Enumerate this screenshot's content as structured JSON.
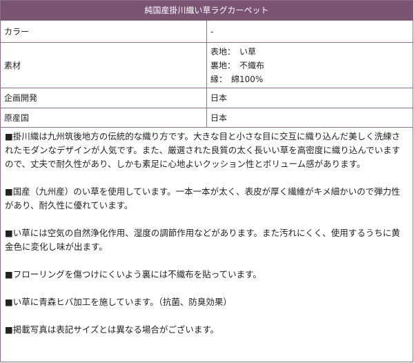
{
  "title": "純国産掛川織い草ラグカーペット",
  "specs": {
    "color": {
      "label": "カラー",
      "value": "-"
    },
    "material": {
      "label": "素材",
      "lines": [
        "表地：　い草",
        "裏地：　不織布",
        "縁：　綿100%"
      ]
    },
    "planning": {
      "label": "企画開発",
      "value": "日本"
    },
    "origin": {
      "label": "原産国",
      "value": "日本"
    }
  },
  "description": [
    "■掛川織は九州筑後地方の伝統的な織り方です。大きな目と小さな目に交互に織り込んだ美しく洗練されたモダンなデザインが人気です。また、厳選された良質の太く長いい草を高密度に織り込んでいますので、丈夫で耐久性があり、しかも素足に心地よいクッション性とボリューム感があります。",
    "■国産（九州産）のい草を使用しています。一本一本が太く、表皮が厚く繊維がキメ細かいので弾力性があり、耐久性に優れています。",
    "■い草には空気の自然浄化作用、湿度の調節作用などがあります。また汚れにくく、使用するうちに黄金色に変化し味が出ます。",
    "■フローリングを傷つけにくいよう裏には不織布を貼っています。",
    "■い草に青森ヒバ加工を施しています。（抗菌、防臭効果）",
    "■掲載写真は表記サイズとは異なる場合がございます。"
  ]
}
